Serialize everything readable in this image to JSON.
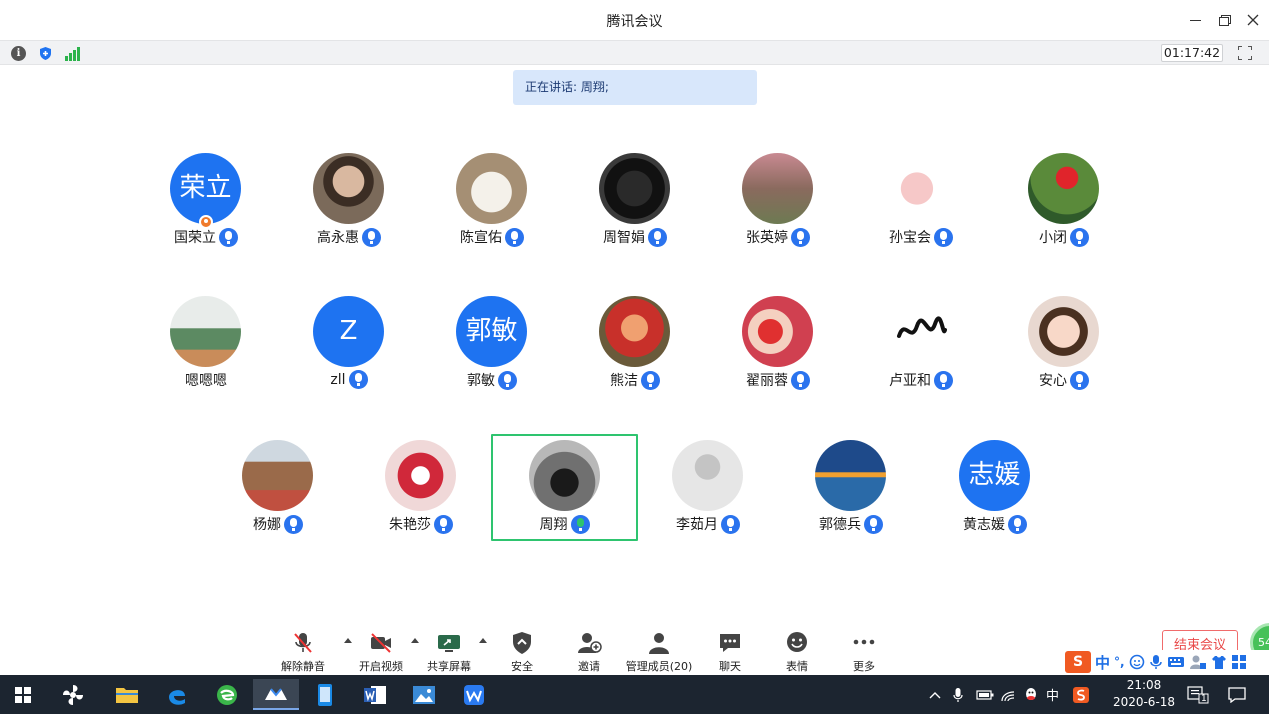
{
  "window": {
    "title": "腾讯会议"
  },
  "status": {
    "timer": "01:17:42"
  },
  "speaking": {
    "text": "正在讲话: 周翔;"
  },
  "participants": [
    {
      "name": "国荣立",
      "avatar_text": "荣立",
      "mic": "on"
    },
    {
      "name": "高永惠",
      "avatar_text": "",
      "mic": "on"
    },
    {
      "name": "陈宣佑",
      "avatar_text": "",
      "mic": "on"
    },
    {
      "name": "周智娟",
      "avatar_text": "",
      "mic": "on"
    },
    {
      "name": "张英婷",
      "avatar_text": "",
      "mic": "on"
    },
    {
      "name": "孙宝会",
      "avatar_text": "",
      "mic": "on"
    },
    {
      "name": "小闭",
      "avatar_text": "",
      "mic": "on"
    },
    {
      "name": "嗯嗯嗯",
      "avatar_text": "",
      "mic": "none"
    },
    {
      "name": "zll",
      "avatar_text": "Z",
      "mic": "on"
    },
    {
      "name": "郭敏",
      "avatar_text": "郭敏",
      "mic": "on"
    },
    {
      "name": "熊洁",
      "avatar_text": "",
      "mic": "on"
    },
    {
      "name": "翟丽蓉",
      "avatar_text": "",
      "mic": "on"
    },
    {
      "name": "卢亚和",
      "avatar_text": "",
      "mic": "on"
    },
    {
      "name": "安心",
      "avatar_text": "",
      "mic": "on"
    },
    {
      "name": "杨娜",
      "avatar_text": "",
      "mic": "on"
    },
    {
      "name": "朱艳莎",
      "avatar_text": "",
      "mic": "on"
    },
    {
      "name": "周翔",
      "avatar_text": "",
      "mic": "speaking"
    },
    {
      "name": "李茹月",
      "avatar_text": "",
      "mic": "on"
    },
    {
      "name": "郭德兵",
      "avatar_text": "",
      "mic": "on"
    },
    {
      "name": "黄志媛",
      "avatar_text": "志媛",
      "mic": "on"
    }
  ],
  "toolbar": {
    "unmute": "解除静音",
    "video": "开启视频",
    "share": "共享屏幕",
    "security": "安全",
    "invite": "邀请",
    "members": "管理成员(20)",
    "chat": "聊天",
    "reactions": "表情",
    "more": "更多",
    "end": "结束会议"
  },
  "ime": {
    "mode": "中",
    "punct": "°,"
  },
  "taskbar": {
    "time": "21:08",
    "date": "2020-6-18",
    "input_lang": "中",
    "notify_count": "1",
    "network_badge": "54"
  },
  "colors": {
    "accent": "#1e73f1",
    "active_border": "#2ec46f",
    "end_red": "#e94848"
  }
}
